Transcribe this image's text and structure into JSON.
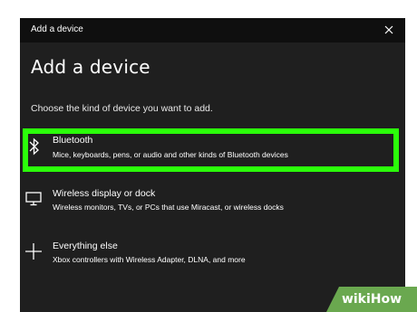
{
  "window": {
    "title": "Add a device"
  },
  "main": {
    "heading": "Add a device",
    "subheading": "Choose the kind of device you want to add."
  },
  "options": [
    {
      "icon": "bluetooth-icon",
      "label": "Bluetooth",
      "description": "Mice, keyboards, pens, or audio and other kinds of Bluetooth devices"
    },
    {
      "icon": "monitor-icon",
      "label": "Wireless display or dock",
      "description": "Wireless monitors, TVs, or PCs that use Miracast, or wireless docks"
    },
    {
      "icon": "plus-icon",
      "label": "Everything else",
      "description": "Xbox controllers with Wireless Adapter, DLNA, and more"
    }
  ],
  "watermark": {
    "text": "wikiHow"
  },
  "colors": {
    "dialog_background": "#1f1f1f",
    "titlebar_background": "#0f0f0f",
    "highlight": "#2bff0a",
    "text": "#ffffff",
    "watermark_background": "#6aa84f"
  }
}
